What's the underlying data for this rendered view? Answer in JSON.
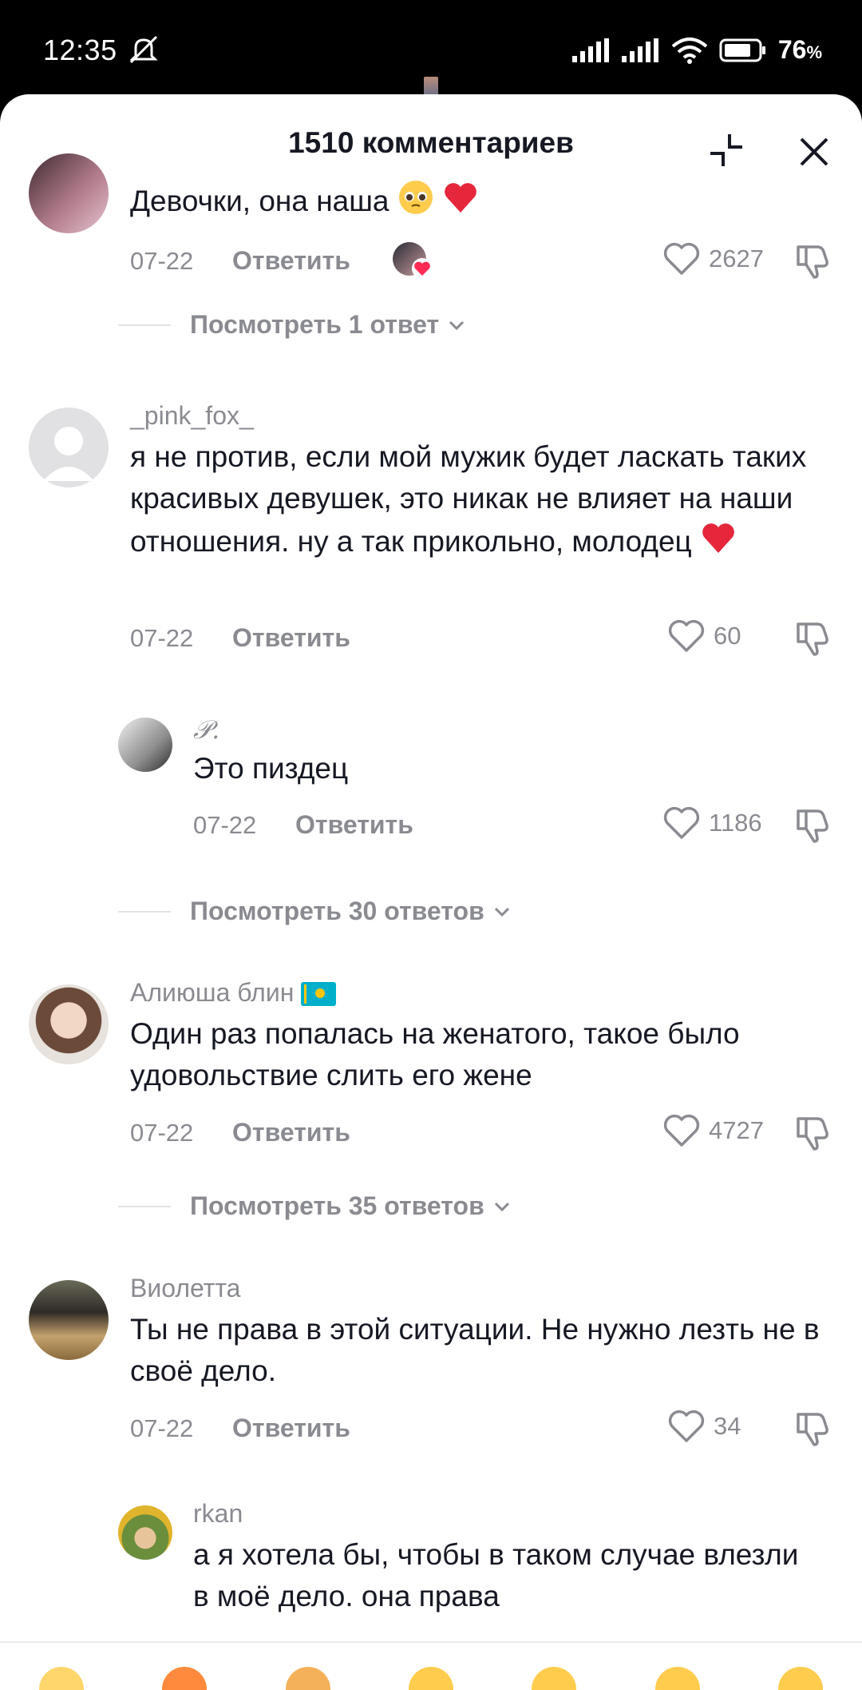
{
  "status_bar": {
    "time": "12:35",
    "battery": "76",
    "battery_unit": "%"
  },
  "header": {
    "title": "1510 комментариев"
  },
  "comments": [
    {
      "username": "",
      "text": "Девочки, она наша",
      "date": "07-22",
      "reply_label": "Ответить",
      "likes": "2627",
      "view_replies": "Посмотреть 1 ответ"
    },
    {
      "username": "_pink_fox_",
      "text": "я не против, если мой мужик будет ласкать таких красивых девушек, это никак не влияет на наши отношения. ну а так прикольно, молодец",
      "date": "07-22",
      "reply_label": "Ответить",
      "likes": "60"
    },
    {
      "username": "𝒫.",
      "text": "Это пиздец",
      "date": "07-22",
      "reply_label": "Ответить",
      "likes": "1186",
      "view_replies": "Посмотреть 30 ответов"
    },
    {
      "username": "Алиюша блин",
      "text": "Один раз попалась на женатого, такое было удовольствие слить его жене",
      "date": "07-22",
      "reply_label": "Ответить",
      "likes": "4727",
      "view_replies": "Посмотреть 35 ответов"
    },
    {
      "username": "Виолетта",
      "text": "Ты не права в этой ситуации. Не нужно лезть не в своё дело.",
      "date": "07-22",
      "reply_label": "Ответить",
      "likes": "34"
    },
    {
      "username": "rkan",
      "text": "а я хотела бы, чтобы в таком случае влезли в моё дело. она права"
    }
  ],
  "colors": {
    "accent_heart": "#fe2c55",
    "muted": "#8a8b91",
    "text": "#161823"
  },
  "icons": [
    "mute-icon",
    "signal-icon",
    "wifi-icon",
    "battery-icon",
    "collapse-icon",
    "close-icon",
    "heart-icon",
    "dislike-icon",
    "chevron-down-icon"
  ]
}
